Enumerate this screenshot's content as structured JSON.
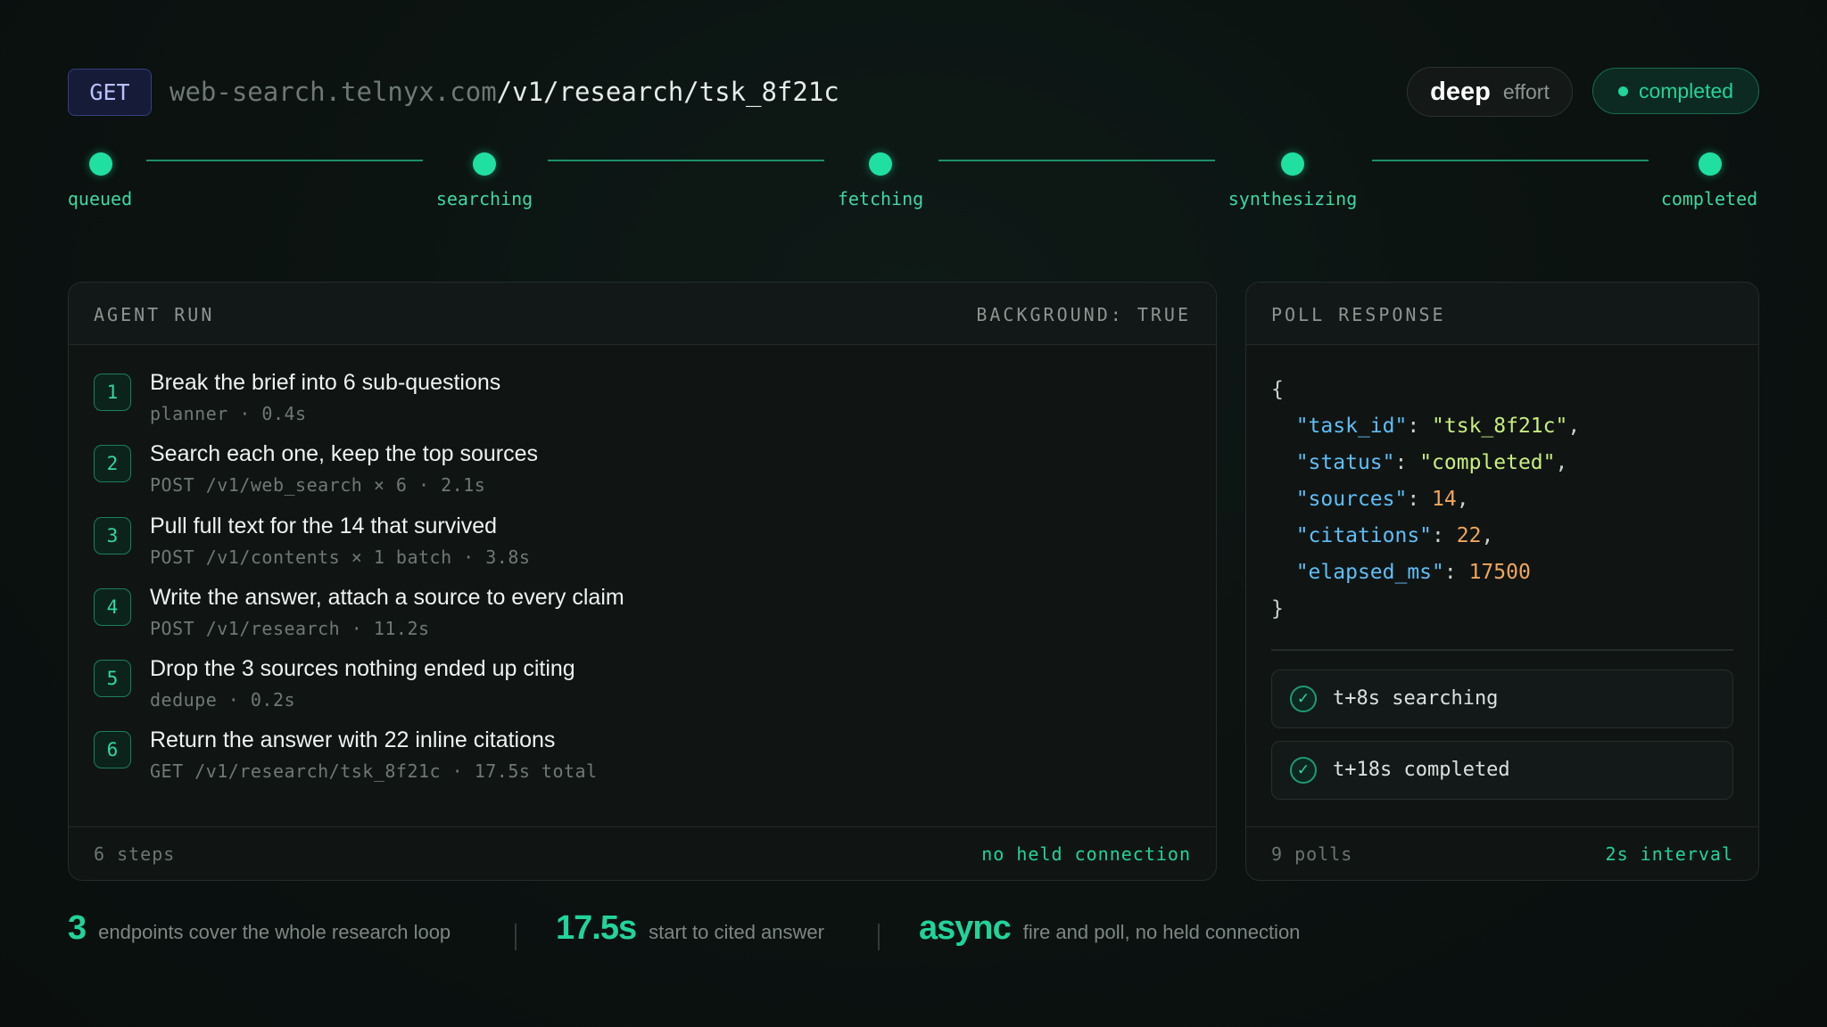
{
  "request": {
    "method": "GET",
    "host": "web-search.telnyx.com",
    "path": "/v1/research/tsk_8f21c",
    "effort_level": "deep",
    "effort_label": "effort",
    "status": "completed",
    "status_color": "#22d39a"
  },
  "stages": [
    "queued",
    "searching",
    "fetching",
    "synthesizing",
    "completed"
  ],
  "agent_run": {
    "title": "AGENT RUN",
    "background": "BACKGROUND: TRUE",
    "steps": [
      {
        "num": "1",
        "title": "Break the brief into 6 sub-questions",
        "meta": "planner · 0.4s"
      },
      {
        "num": "2",
        "title": "Search each one, keep the top sources",
        "meta": "POST /v1/web_search × 6 · 2.1s"
      },
      {
        "num": "3",
        "title": "Pull full text for the 14 that survived",
        "meta": "POST /v1/contents × 1 batch · 3.8s"
      },
      {
        "num": "4",
        "title": "Write the answer, attach a source to every claim",
        "meta": "POST /v1/research · 11.2s"
      },
      {
        "num": "5",
        "title": "Drop the 3 sources nothing ended up citing",
        "meta": "dedupe · 0.2s"
      },
      {
        "num": "6",
        "title": "Return the answer with 22 inline citations",
        "meta": "GET /v1/research/tsk_8f21c · 17.5s total"
      }
    ],
    "footer_left": "6 steps",
    "footer_right": "no held connection"
  },
  "poll_response": {
    "title": "POLL RESPONSE",
    "json": {
      "task_id": "\"tsk_8f21c\"",
      "status": "\"completed\"",
      "sources": "14",
      "citations": "22",
      "elapsed_ms": "17500"
    },
    "polls": [
      "t+8s searching",
      "t+18s completed"
    ],
    "footer_left": "9 polls",
    "footer_right": "2s interval"
  },
  "stats": [
    {
      "value": "3",
      "label": "endpoints cover the whole research loop"
    },
    {
      "value": "17.5s",
      "label": "start to cited answer"
    },
    {
      "value": "async",
      "label": "fire and poll, no held connection"
    }
  ],
  "colors": {
    "accent": "#22d39a",
    "background": "#0b1110",
    "json_key": "#5fbef5",
    "json_string": "#c9ee7d",
    "json_number": "#f2a65a"
  }
}
